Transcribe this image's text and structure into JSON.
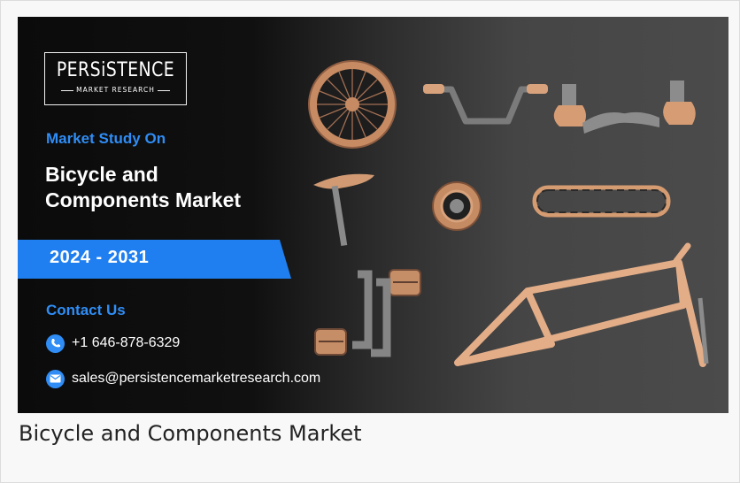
{
  "banner": {
    "logo_main": "PERSiSTENCE",
    "logo_sub": "MARKET RESEARCH",
    "study_label": "Market Study On",
    "title_line1": "Bicycle and",
    "title_line2": "Components Market",
    "years": "2024 - 2031",
    "contact_label": "Contact Us",
    "phone": "+1 646-878-6329",
    "email": "sales@persistencemarketresearch.com"
  },
  "caption": "Bicycle and Components Market",
  "colors": {
    "accent_blue": "#1f7ff0",
    "copper": "#d79a72",
    "dark_background": "#0b0b0b"
  },
  "icons": [
    "phone-icon",
    "email-icon"
  ]
}
